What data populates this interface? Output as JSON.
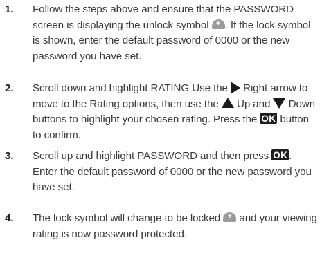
{
  "steps": [
    {
      "number": "1.",
      "parts": [
        "Follow the steps above and ensure that the PASSWORD screen is displaying the unlock symbol",
        ". If the lock symbol is shown, enter the default password of 0000 or the new password you have set."
      ]
    },
    {
      "number": "2.",
      "parts": [
        "Scroll down and highlight RATING Use the",
        "Right arrow to move to the Rating options, then use the",
        "Up and",
        "Down buttons to highlight your chosen rating. Press the",
        "button to confirm."
      ],
      "ok_label": "OK"
    },
    {
      "number": "3.",
      "parts": [
        "Scroll up and highlight PASSWORD and then press",
        ". Enter the default password of 0000 or the new password you have set."
      ],
      "ok_label": "OK"
    },
    {
      "number": "4.",
      "parts": [
        "The lock symbol will change to be locked",
        "and your viewing rating is now password protected."
      ]
    }
  ],
  "icons": {
    "unlock": "unlock-icon",
    "lock": "lock-icon",
    "right_arrow": "right-arrow-icon",
    "up_arrow": "up-arrow-icon",
    "down_arrow": "down-arrow-icon"
  },
  "colors": {
    "text": "#3b3b3b",
    "number": "#222222",
    "icon_gray": "#9b9b9b",
    "ok_bg": "#1f1f1f"
  }
}
